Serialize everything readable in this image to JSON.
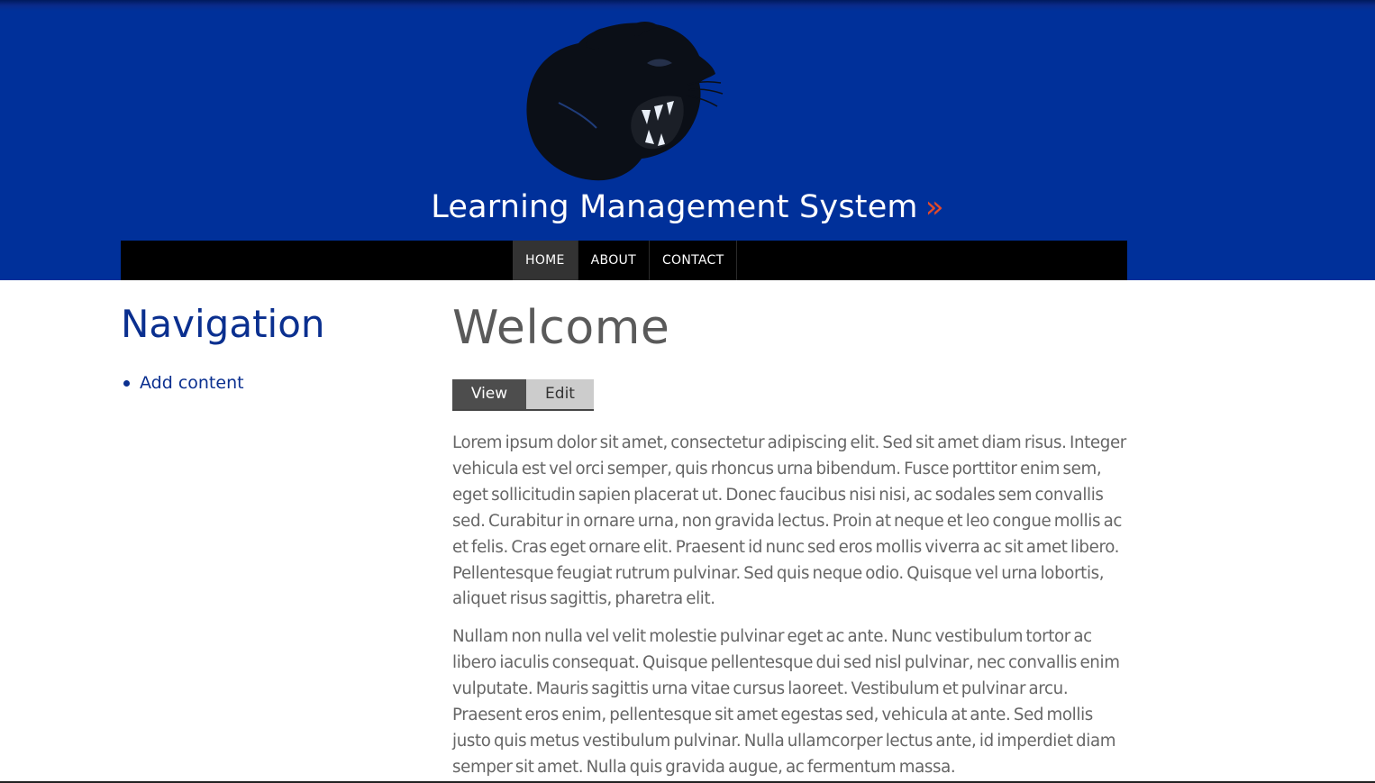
{
  "header": {
    "logo_icon": "panther-icon",
    "title": "Learning Management System",
    "title_suffix": "»",
    "background_color": "#00309a",
    "accent_color": "#e24a2a"
  },
  "menu": {
    "items": [
      {
        "label": "HOME",
        "active": true
      },
      {
        "label": "ABOUT",
        "active": false
      },
      {
        "label": "CONTACT",
        "active": false
      }
    ]
  },
  "sidebar": {
    "heading": "Navigation",
    "links": [
      {
        "label": "Add content"
      }
    ]
  },
  "main": {
    "title": "Welcome",
    "tabs": [
      {
        "label": "View",
        "active": true
      },
      {
        "label": "Edit",
        "active": false
      }
    ],
    "paragraphs": [
      "Lorem ipsum dolor sit amet, consectetur adipiscing elit. Sed sit amet diam risus. Integer vehicula est vel orci semper, quis rhoncus urna bibendum. Fusce porttitor enim sem, eget sollicitudin sapien placerat ut. Donec faucibus nisi nisi, ac sodales sem convallis sed. Curabitur in ornare urna, non gravida lectus. Proin at neque et leo congue mollis ac et felis. Cras eget ornare elit. Praesent id nunc sed eros mollis viverra ac sit amet libero. Pellentesque feugiat rutrum pulvinar. Sed quis neque odio. Quisque vel urna lobortis, aliquet risus sagittis, pharetra elit.",
      "Nullam non nulla vel velit molestie pulvinar eget ac ante. Nunc vestibulum tortor ac libero iaculis consequat. Quisque pellentesque dui sed nisl pulvinar, nec convallis enim vulputate. Mauris sagittis urna vitae cursus laoreet. Vestibulum et pulvinar arcu. Praesent eros enim, pellentesque sit amet egestas sed, vehicula at ante. Sed mollis justo quis metus vestibulum pulvinar. Nulla ullamcorper lectus ante, id imperdiet diam semper sit amet. Nulla quis gravida augue, ac fermentum massa."
    ]
  }
}
